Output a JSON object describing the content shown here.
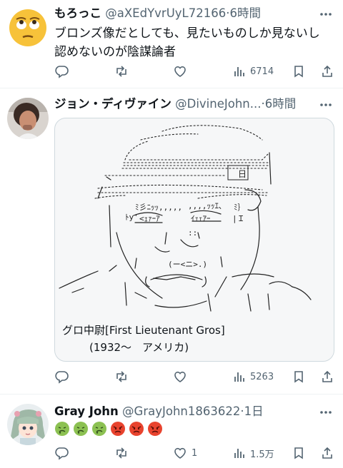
{
  "posts": [
    {
      "display_name": "もろっこ",
      "handle": "@aXEdYvrUyL72166",
      "sep": "·",
      "time": "6時間",
      "text_line1": "ブロンズ像だとしても、見たいものしか見ないし",
      "text_line2": "認めないのが陰謀論者",
      "views": "6714",
      "avatar_icon": "rolling-eyes-emoji-icon"
    },
    {
      "display_name": "ジョン・ディヴァイン",
      "handle": "@DivineJohn...",
      "sep": "·",
      "time": "6時間",
      "aa_caption_line1": "グロ中尉[First Lieutenant Gros]",
      "aa_caption_line2": "(1932〜　アメリカ)",
      "aa_mark": "日",
      "views": "5263"
    },
    {
      "display_name": "Gray John",
      "handle": "@GrayJohn1863622",
      "sep": "·",
      "time": "1日",
      "emojis": [
        "nauseated-face",
        "nauseated-face",
        "nauseated-face",
        "angry-face",
        "angry-face",
        "angry-face"
      ],
      "likes": "1",
      "views": "1.5万"
    }
  ],
  "colors": {
    "text": "#0f1419",
    "secondary": "#536471",
    "divider": "#eff3f4",
    "card_bg": "#f6f7f8",
    "card_border": "#cfd9de"
  }
}
